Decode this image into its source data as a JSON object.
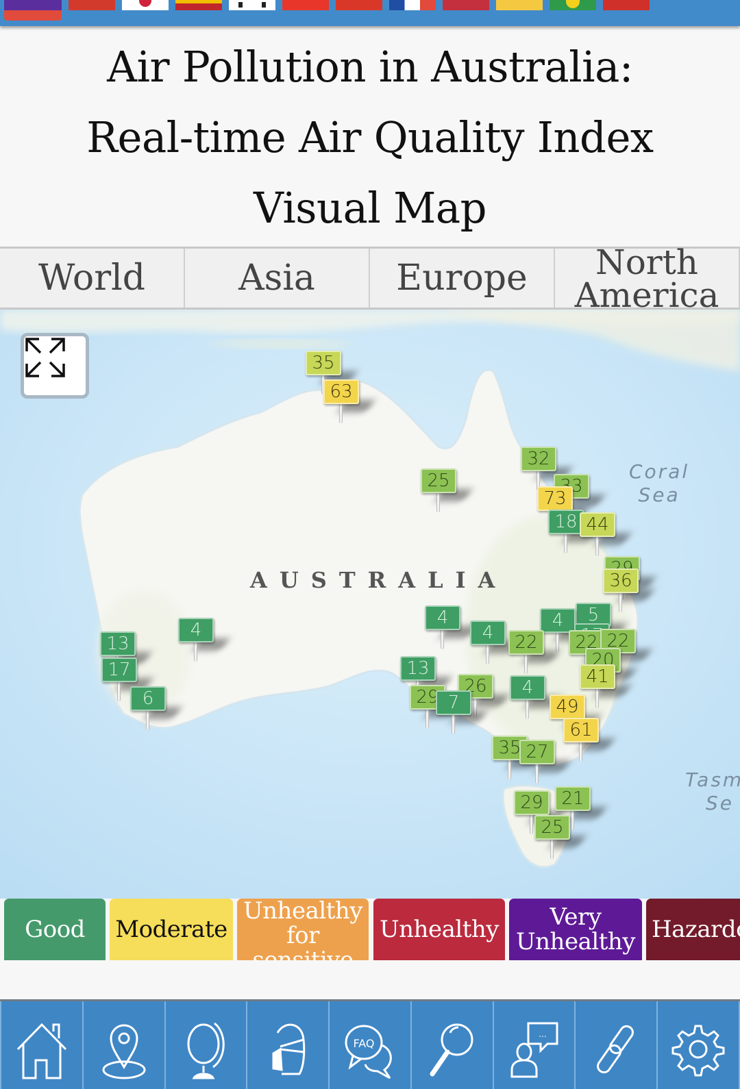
{
  "flag_bar": {
    "flags": [
      {
        "name": "multi",
        "color_top": "#5b2e9e",
        "color_bottom": "#e04b3c"
      },
      {
        "name": "china",
        "color": "#d23b2b"
      },
      {
        "name": "japan",
        "color": "#ffffff",
        "accent": "#d0223d"
      },
      {
        "name": "spain",
        "color": "#c0272d",
        "accent": "#f1bf00"
      },
      {
        "name": "south-korea",
        "color": "#ffffff",
        "accent": "#1d1d1d"
      },
      {
        "name": "vietnam",
        "color": "#e8372a"
      },
      {
        "name": "hong-kong",
        "color": "#d93829"
      },
      {
        "name": "france",
        "color": "#ffffff",
        "accent": "#1f4ea2"
      },
      {
        "name": "indonesia",
        "color": "#c5303e"
      },
      {
        "name": "yellow",
        "color": "#f5c842"
      },
      {
        "name": "brazil",
        "color": "#2f9a4a",
        "accent": "#f2d01c"
      },
      {
        "name": "vietnam-2",
        "color": "#d0302a"
      }
    ]
  },
  "header": {
    "title_lines": [
      "Air Pollution in Australia:",
      "Real-time Air Quality Index",
      "Visual Map"
    ]
  },
  "tabs": [
    {
      "label": "World"
    },
    {
      "label": "Asia"
    },
    {
      "label": "Europe"
    },
    {
      "label_line1": "North",
      "label_line2": "America"
    }
  ],
  "map": {
    "country_label": "AUSTRALIA",
    "sea_labels": [
      {
        "line1": "Coral",
        "line2": "Sea"
      },
      {
        "line1": "Tasm",
        "line2": "Se"
      }
    ],
    "fullscreen_icon": "expand-arrows-icon",
    "markers": [
      {
        "aqi": "35",
        "level": "moderate-low"
      },
      {
        "aqi": "63",
        "level": "moderate"
      },
      {
        "aqi": "25",
        "level": "good-high"
      },
      {
        "aqi": "32",
        "level": "good-high"
      },
      {
        "aqi": "33",
        "level": "good-high"
      },
      {
        "aqi": "73",
        "level": "moderate"
      },
      {
        "aqi": "18",
        "level": "good"
      },
      {
        "aqi": "44",
        "level": "moderate-low"
      },
      {
        "aqi": "29",
        "level": "good-high"
      },
      {
        "aqi": "36",
        "level": "moderate-low"
      },
      {
        "aqi": "4",
        "level": "good"
      },
      {
        "aqi": "13",
        "level": "good"
      },
      {
        "aqi": "4",
        "level": "good"
      },
      {
        "aqi": "6",
        "level": "good"
      },
      {
        "aqi": "4",
        "level": "good"
      },
      {
        "aqi": "4",
        "level": "good"
      },
      {
        "aqi": "5",
        "level": "good"
      },
      {
        "aqi": "17",
        "level": "good"
      },
      {
        "aqi": "22",
        "level": "good-high"
      },
      {
        "aqi": "22",
        "level": "good-high"
      },
      {
        "aqi": "22",
        "level": "good-high"
      },
      {
        "aqi": "13",
        "level": "good"
      },
      {
        "aqi": "29",
        "level": "good-high"
      },
      {
        "aqi": "26",
        "level": "good-high"
      },
      {
        "aqi": "7",
        "level": "good"
      },
      {
        "aqi": "4",
        "level": "good"
      },
      {
        "aqi": "20",
        "level": "good-high"
      },
      {
        "aqi": "41",
        "level": "moderate-low"
      },
      {
        "aqi": "49",
        "level": "moderate"
      },
      {
        "aqi": "61",
        "level": "moderate"
      },
      {
        "aqi": "35",
        "level": "good-high"
      },
      {
        "aqi": "27",
        "level": "good-high"
      },
      {
        "aqi": "29",
        "level": "good-high"
      },
      {
        "aqi": "25",
        "level": "good-high"
      },
      {
        "aqi": "21",
        "level": "good-high"
      },
      {
        "aqi": "17",
        "level": "good"
      }
    ],
    "level_colors": {
      "good": "#3f9e63",
      "good-high": "#8cc153",
      "moderate-low": "#c7d758",
      "moderate": "#f3d54c"
    }
  },
  "legend": [
    {
      "label": "Good",
      "color": "#459a6c",
      "text_color": "#ffffff"
    },
    {
      "label": "Moderate",
      "color": "#f6dd5a",
      "text_color": "#111111"
    },
    {
      "label_line1": "Unhealthy",
      "label_line2": "for",
      "label_line3": "sensitive",
      "color": "#eea14d",
      "text_color": "#ffffff"
    },
    {
      "label": "Unhealthy",
      "color": "#bb2a3d",
      "text_color": "#ffffff"
    },
    {
      "label_line1": "Very",
      "label_line2": "Unhealthy",
      "color": "#5e1a96",
      "text_color": "#ffffff"
    },
    {
      "label": "Hazardous",
      "color": "#731b2b",
      "text_color": "#ffffff"
    }
  ],
  "bottom_nav": [
    {
      "icon": "home-icon"
    },
    {
      "icon": "location-pin-icon"
    },
    {
      "icon": "globe-icon"
    },
    {
      "icon": "face-mask-icon"
    },
    {
      "icon": "faq-icon"
    },
    {
      "icon": "search-icon"
    },
    {
      "icon": "chat-user-icon"
    },
    {
      "icon": "link-icon"
    },
    {
      "icon": "gear-icon"
    }
  ]
}
